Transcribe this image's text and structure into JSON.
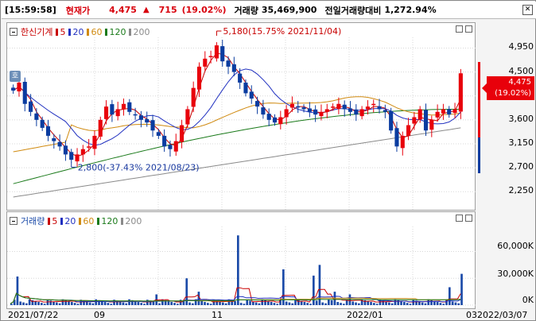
{
  "header": {
    "time": "[15:59:58]",
    "current_label": "현재가",
    "price": "4,475",
    "direction_icon": "up-triangle-icon",
    "change": "715",
    "change_pct": "(19.02%)",
    "volume_label": "거래량",
    "volume": "35,469,900",
    "ratio_label": "전일거래량대비",
    "ratio": "1,272.94%"
  },
  "colors": {
    "up": "#e8000b",
    "down": "#0a3ca0",
    "ma5": "#c80000",
    "ma20": "#2030c0",
    "ma60": "#d08a10",
    "ma120": "#1a7a1a",
    "ma200": "#8a8a8a"
  },
  "price_panel": {
    "legend": {
      "name": "한신기계",
      "ma": [
        {
          "label": "5",
          "color": "#c80000"
        },
        {
          "label": "20",
          "color": "#2030c0"
        },
        {
          "label": "60",
          "color": "#d08a10"
        },
        {
          "label": "120",
          "color": "#1a7a1a"
        },
        {
          "label": "200",
          "color": "#8a8a8a"
        }
      ]
    },
    "side_button": "호",
    "y_ticks": [
      "4,950",
      "4,500",
      "4,050",
      "3,600",
      "3,150",
      "2,700",
      "2,250"
    ],
    "current_price_tag": "4,475",
    "current_pct_tag": "(19.02%)",
    "high_annotation": "5,180(15.75% 2021/11/04)",
    "low_annotation": "2,800(-37.43% 2021/08/23)"
  },
  "volume_panel": {
    "legend": {
      "name": "거래량",
      "ma": [
        {
          "label": "5",
          "color": "#c80000"
        },
        {
          "label": "20",
          "color": "#2030c0"
        },
        {
          "label": "60",
          "color": "#d08a10"
        },
        {
          "label": "120",
          "color": "#1a7a1a"
        },
        {
          "label": "200",
          "color": "#8a8a8a"
        }
      ]
    },
    "y_ticks": [
      "60,000K",
      "30,000K",
      "0K"
    ]
  },
  "x_axis": {
    "labels": [
      "2021/07/22",
      "09",
      "11",
      "2022/01",
      "03",
      "2022/03/07"
    ]
  },
  "chart_data": {
    "type": "candlestick",
    "high": {
      "value": 5180,
      "date": "2021/11/04",
      "pct": 15.75
    },
    "low": {
      "value": 2800,
      "date": "2021/08/23",
      "pct": -37.43
    },
    "last": 4475,
    "ylim": [
      2000,
      5300
    ],
    "closes": [
      4150,
      4300,
      3900,
      3750,
      3600,
      3450,
      3300,
      3200,
      3100,
      2950,
      2850,
      2950,
      3050,
      3100,
      3300,
      3600,
      3850,
      3700,
      3800,
      3900,
      3750,
      3700,
      3600,
      3550,
      3400,
      3300,
      3100,
      3050,
      3200,
      3500,
      3800,
      4200,
      4600,
      4750,
      4800,
      5000,
      4700,
      4600,
      4500,
      4300,
      4100,
      4000,
      3850,
      3700,
      3600,
      3550,
      3650,
      3800,
      3900,
      3850,
      3800,
      3750,
      3700,
      3750,
      3800,
      3850,
      3900,
      3800,
      3750,
      3700,
      3800,
      3850,
      3900,
      3800,
      3750,
      3400,
      3100,
      3300,
      3500,
      3650,
      3800,
      3400,
      3600,
      3750,
      3800,
      3700,
      3800,
      4475
    ],
    "volume_max": 80000
  }
}
